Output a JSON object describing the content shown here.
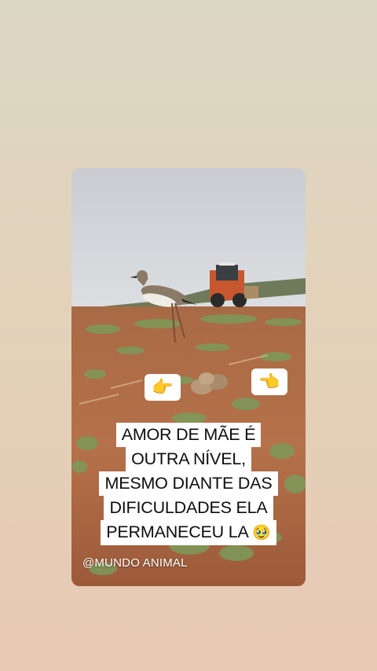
{
  "post": {
    "pointer_left": "👉",
    "pointer_right": "👈",
    "caption_lines": [
      "AMOR DE MÃE É",
      "OUTRA NÍVEL,",
      "MESMO DIANTE DAS",
      "DIFICULDADES ELA",
      "PERMANECEU LA"
    ],
    "caption_emoji": "🥹",
    "watermark": "@MUNDO ANIMAL"
  },
  "colors": {
    "background_top": "#dcd7c4",
    "background_bottom": "#e8c9b4",
    "caption_bg": "#ffffff",
    "caption_text": "#0d0d0d"
  }
}
